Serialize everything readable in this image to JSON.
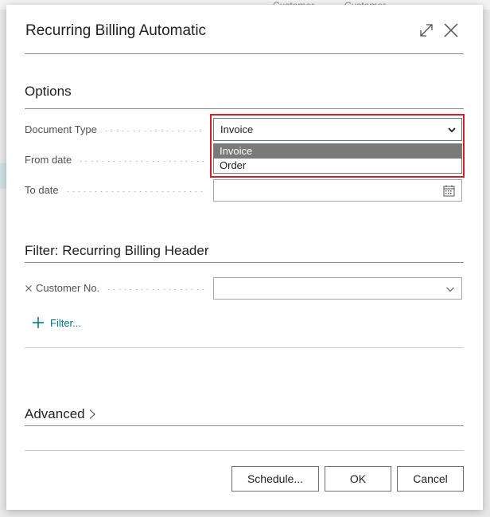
{
  "background": {
    "columns": [
      "Customer",
      "Customer"
    ]
  },
  "dialog": {
    "title": "Recurring Billing Automatic"
  },
  "icons": {
    "expand": "expand-icon",
    "close": "close-icon",
    "calendar": "calendar-icon",
    "chevron": "chevron-down-icon",
    "remove": "remove-filter-icon",
    "plus": "plus-icon",
    "chevron_right": "chevron-right-icon"
  },
  "options": {
    "section_title": "Options",
    "document_type": {
      "label": "Document Type",
      "value": "Invoice",
      "options": [
        "Invoice",
        "Order"
      ]
    },
    "from_date": {
      "label": "From date",
      "value": ""
    },
    "to_date": {
      "label": "To date",
      "value": ""
    }
  },
  "filter": {
    "section_title": "Filter: Recurring Billing Header",
    "customer_no": {
      "label": "Customer No.",
      "value": ""
    },
    "add_filter_label": "Filter..."
  },
  "advanced": {
    "label": "Advanced"
  },
  "buttons": {
    "schedule": "Schedule...",
    "ok": "OK",
    "cancel": "Cancel"
  },
  "colors": {
    "accent": "#00747d",
    "highlight": "#d2202a",
    "selected_option": "#7a7a7a"
  }
}
